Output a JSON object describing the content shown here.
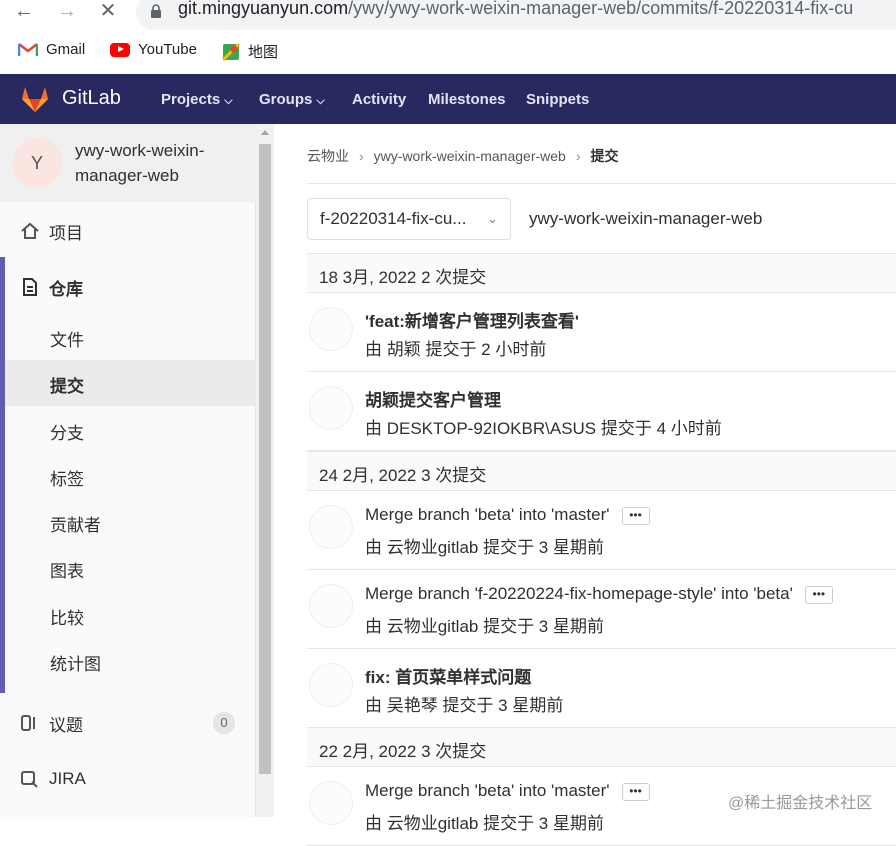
{
  "browser": {
    "url_host": "git.mingyuanyun.com",
    "url_path": "/ywy/ywy-work-weixin-manager-web/commits/f-20220314-fix-cu",
    "bookmarks": [
      {
        "label": "Gmail",
        "icon": "gmail-icon"
      },
      {
        "label": "YouTube",
        "icon": "youtube-icon"
      },
      {
        "label": "地图",
        "icon": "maps-icon"
      }
    ]
  },
  "header": {
    "brand": "GitLab",
    "menu": [
      {
        "label": "Projects",
        "dropdown": true
      },
      {
        "label": "Groups",
        "dropdown": true
      },
      {
        "label": "Activity",
        "dropdown": false
      },
      {
        "label": "Milestones",
        "dropdown": false
      },
      {
        "label": "Snippets",
        "dropdown": false
      }
    ],
    "colors": {
      "bg": "#292961",
      "accent": "#e24329"
    }
  },
  "sidebar": {
    "avatar_letter": "Y",
    "project_name": "ywy-work-weixin-manager-web",
    "items": [
      {
        "label": "项目",
        "icon": "home-icon"
      },
      {
        "label": "仓库",
        "icon": "document-icon"
      },
      {
        "label": "议题",
        "icon": "issues-icon",
        "count": "0"
      },
      {
        "label": "JIRA",
        "icon": "jira-icon"
      }
    ],
    "repo_sub": [
      "文件",
      "提交",
      "分支",
      "标签",
      "贡献者",
      "图表",
      "比较",
      "统计图"
    ],
    "active_sub": "提交"
  },
  "main": {
    "breadcrumb": [
      "云物业",
      "ywy-work-weixin-manager-web",
      "提交"
    ],
    "branch": "f-20220314-fix-cu...",
    "project_path": "ywy-work-weixin-manager-web",
    "days": [
      {
        "heading": "18 3月, 2022 2 次提交",
        "commits": [
          {
            "title": "'feat:新增客户管理列表查看'",
            "meta": "由 胡颖 提交于 2 小时前",
            "more": false
          },
          {
            "title": "胡颖提交客户管理",
            "meta": "由 DESKTOP-92IOKBR\\ASUS 提交于 4 小时前",
            "more": false
          }
        ]
      },
      {
        "heading": "24 2月, 2022 3 次提交",
        "commits": [
          {
            "title": "Merge branch 'beta' into 'master'",
            "meta": "由 云物业gitlab 提交于 3 星期前",
            "more": true
          },
          {
            "title": "Merge branch 'f-20220224-fix-homepage-style' into 'beta'",
            "meta": "由 云物业gitlab 提交于 3 星期前",
            "more": true
          },
          {
            "title": "fix: 首页菜单样式问题",
            "meta": "由 吴艳琴 提交于 3 星期前",
            "more": false
          }
        ]
      },
      {
        "heading": "22 2月, 2022 3 次提交",
        "commits": [
          {
            "title": "Merge branch 'beta' into 'master'",
            "meta": "由 云物业gitlab 提交于 3 星期前",
            "more": true
          }
        ]
      }
    ],
    "more_label": "•••"
  },
  "watermark": "@稀土掘金技术社区"
}
